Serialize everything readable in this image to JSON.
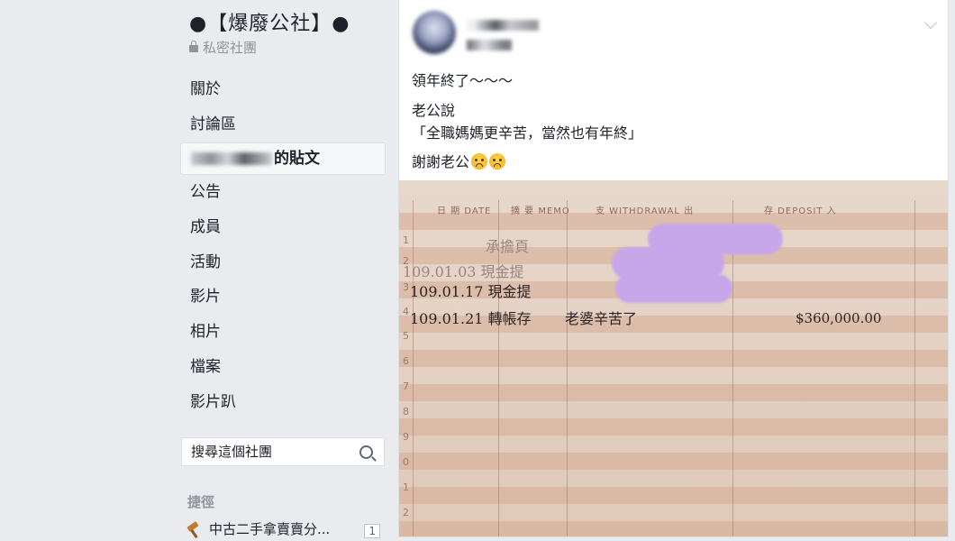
{
  "group": {
    "title": "●【爆廢公社】●",
    "privacy": "私密社團"
  },
  "nav": {
    "items": [
      {
        "label": "關於"
      },
      {
        "label": "討論區"
      },
      {
        "label": "的貼文"
      },
      {
        "label": "公告"
      },
      {
        "label": "成員"
      },
      {
        "label": "活動"
      },
      {
        "label": "影片"
      },
      {
        "label": "相片"
      },
      {
        "label": "檔案"
      },
      {
        "label": "影片趴"
      }
    ]
  },
  "search": {
    "placeholder": "搜尋這個社團"
  },
  "shortcuts": {
    "heading": "捷徑",
    "items": [
      {
        "label": "中古二手拿賣賣分...",
        "count": "1"
      }
    ]
  },
  "post": {
    "lines": [
      "領年終了～～～",
      "老公說",
      "「全職媽媽更辛苦，當然也有年終」",
      "謝謝老公"
    ],
    "photo": {
      "headers": {
        "date": "日 期 DATE",
        "memo": "摘 要 MEMO",
        "withdrawal": "支 WITHDRAWAL 出",
        "deposit": "存 DEPOSIT 入"
      },
      "row_numbers": [
        "1",
        "2",
        "3",
        "4",
        "5",
        "6",
        "7",
        "8",
        "9",
        "0",
        "1",
        "2"
      ],
      "entries": [
        {
          "text": "承擔頁"
        },
        {
          "text": "109.01.03 現金提"
        },
        {
          "text": "109.01.17 現金提"
        },
        {
          "text": "109.01.21 轉帳存"
        },
        {
          "text": "老婆辛苦了"
        },
        {
          "text": "$360,000.00"
        }
      ]
    }
  },
  "colors": {
    "background": "#e9ebee",
    "muted": "#90949c",
    "redaction": "#c7a7ea",
    "passbook": "#e7d8cc"
  },
  "icons": [
    "lock-icon",
    "search-icon",
    "gavel-icon",
    "chevron-down-icon",
    "crying-face-emoji"
  ]
}
